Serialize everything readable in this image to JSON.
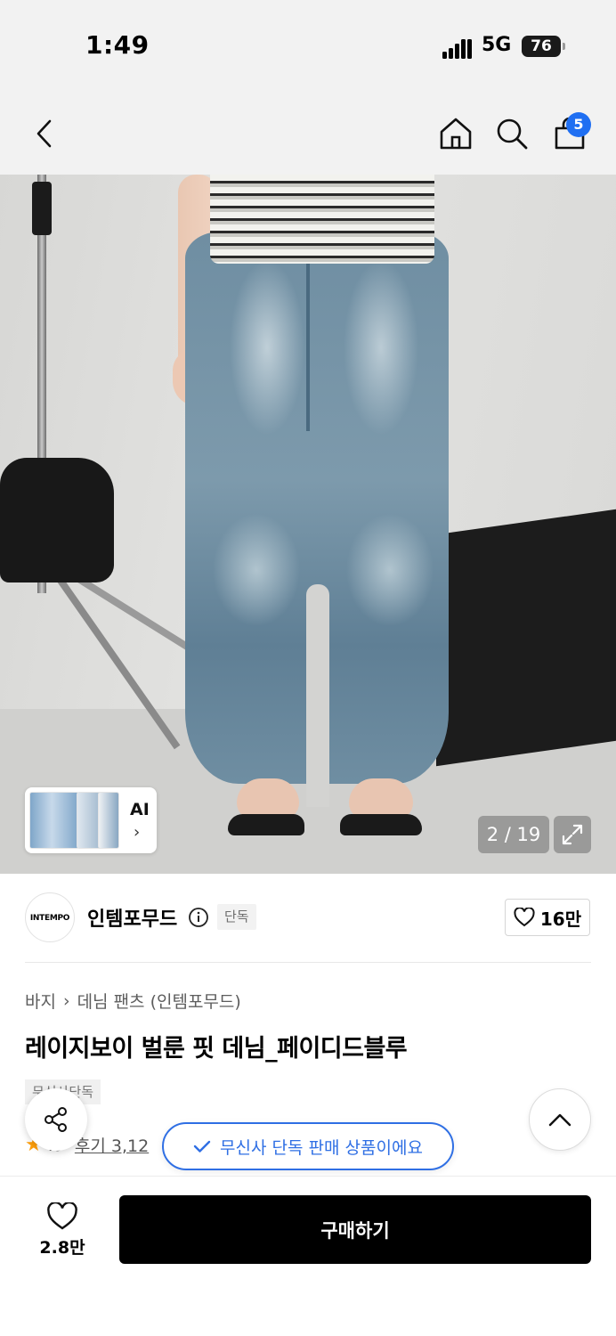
{
  "status_bar": {
    "time": "1:49",
    "network": "5G",
    "battery": "76"
  },
  "top_nav": {
    "back_icon": "chevron-left-icon",
    "home_icon": "home-icon",
    "search_icon": "search-icon",
    "cart_icon": "shopping-bag-icon",
    "cart_count": "5"
  },
  "gallery": {
    "ai_label": "AI",
    "counter": "2 / 19",
    "expand_icon": "expand-icon"
  },
  "brand": {
    "logo_text": "INTEMPO",
    "name": "인템포무드",
    "badge": "단독",
    "likes": "16만"
  },
  "product": {
    "breadcrumb": [
      "바지",
      "데님 팬츠 (인템포무드)"
    ],
    "title": "레이지보이 벌룬 핏 데님_페이디드블루",
    "tag": "무신사단독",
    "rating": ".9",
    "review_label": "후기 3,12"
  },
  "toast": {
    "text": "무신사 단독 판매 상품이에요"
  },
  "bottom_bar": {
    "wish_count": "2.8만",
    "buy_label": "구매하기"
  },
  "colors": {
    "accent_blue": "#2f6fe4",
    "badge_blue": "#1f6ff2",
    "star": "#ff9f0a",
    "buy_button": "#000000"
  }
}
